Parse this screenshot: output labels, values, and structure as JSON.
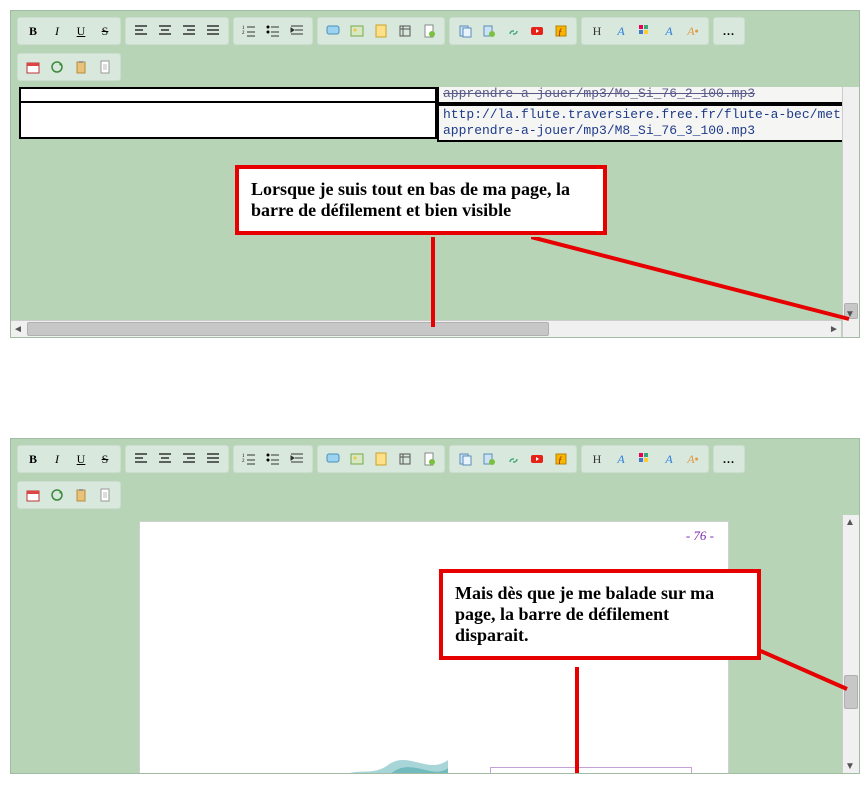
{
  "toolbar": {
    "bold": "B",
    "italic": "I",
    "underline": "U",
    "strike": "S",
    "more": "..."
  },
  "content_top": {
    "url_partial": "apprendre-a-jouer/mp3/Mo_Si_76_2_100.mp3",
    "url_full_line1": "http://la.flute.traversiere.free.fr/flute-a-bec/methode-pour-",
    "url_full_line2": "apprendre-a-jouer/mp3/M8_Si_76_3_100.mp3"
  },
  "callouts": {
    "top": "Lorsque je suis tout en bas de ma page, la barre de défilement et bien visible",
    "bottom": "Mais dès que je me balade sur ma page, la barre de défilement disparait."
  },
  "page2": {
    "page_number": "- 76 -"
  }
}
